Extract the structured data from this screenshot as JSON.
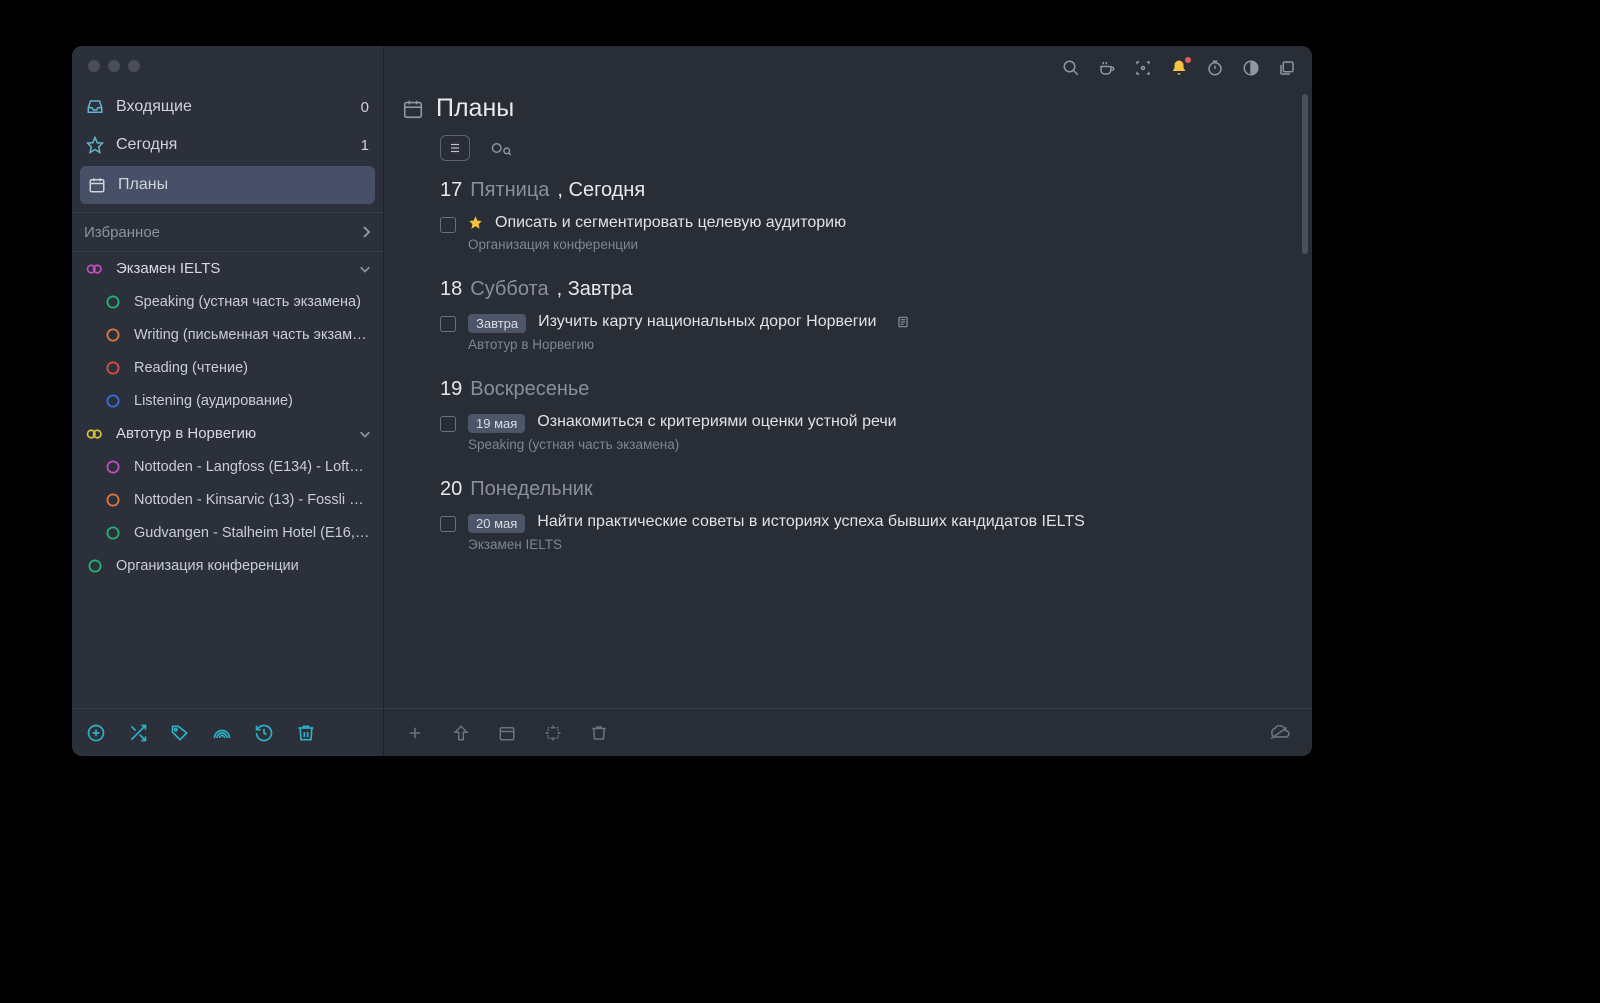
{
  "sidebar": {
    "nav": [
      {
        "icon": "inbox-icon",
        "label": "Входящие",
        "count": "0",
        "selected": false
      },
      {
        "icon": "star-icon",
        "label": "Сегодня",
        "count": "1",
        "selected": false
      },
      {
        "icon": "calendar-icon",
        "label": "Планы",
        "count": "",
        "selected": true
      }
    ],
    "favorites_label": "Избранное",
    "projects": [
      {
        "type": "group",
        "color": "#c24fc2",
        "label": "Экзамен IELTS",
        "expanded": true
      },
      {
        "type": "child",
        "ring": "#1fb573",
        "label": "Speaking (устная часть экзамена)"
      },
      {
        "type": "child",
        "ring": "#e07a3a",
        "label": "Writing (письменная часть экзам…"
      },
      {
        "type": "child",
        "ring": "#e04a4a",
        "label": "Reading (чтение)"
      },
      {
        "type": "child",
        "ring": "#3a6fe0",
        "label": "Listening (аудирование)"
      },
      {
        "type": "group",
        "color": "#d9c23a",
        "label": "Автотур в Норвегию",
        "expanded": true
      },
      {
        "type": "child",
        "ring": "#c24fc2",
        "label": "Nottoden - Langfoss (E134) - Loft…"
      },
      {
        "type": "child",
        "ring": "#e07a3a",
        "label": "Nottoden - Kinsarvic (13) - Fossli …"
      },
      {
        "type": "child",
        "ring": "#1fb573",
        "label": "Gudvangen - Stalheim Hotel (E16,…"
      },
      {
        "type": "project",
        "ring": "#1fb573",
        "label": "Организация конференции"
      }
    ]
  },
  "header": {
    "title": "Планы"
  },
  "days": [
    {
      "num": "17",
      "weekday": "Пятница",
      "rel": ", Сегодня",
      "tasks": [
        {
          "star": true,
          "badge": "",
          "title": "Описать и сегментировать целевую аудиторию",
          "note": false,
          "project": "Организация конференции"
        }
      ]
    },
    {
      "num": "18",
      "weekday": "Суббота",
      "rel": ", Завтра",
      "tasks": [
        {
          "star": false,
          "badge": "Завтра",
          "title": "Изучить карту национальных дорог Норвегии",
          "note": true,
          "project": "Автотур в Норвегию"
        }
      ]
    },
    {
      "num": "19",
      "weekday": "Воскресенье",
      "rel": "",
      "tasks": [
        {
          "star": false,
          "badge": "19 мая",
          "title": "Ознакомиться с критериями оценки устной речи",
          "note": false,
          "project": "Speaking (устная часть экзамена)"
        }
      ]
    },
    {
      "num": "20",
      "weekday": "Понедельник",
      "rel": "",
      "tasks": [
        {
          "star": false,
          "badge": "20 мая",
          "title": "Найти практические советы в историях успеха бывших кандидатов IELTS",
          "note": false,
          "project": "Экзамен IELTS"
        }
      ]
    }
  ]
}
